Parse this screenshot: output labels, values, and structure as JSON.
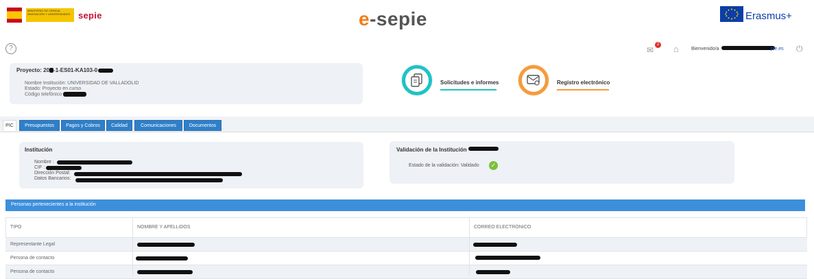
{
  "header": {
    "sepie_logo": "sepie",
    "gov_logo_text": "MINISTERIO DE CIENCIA, INNOVACIÓN Y UNIVERSIDADES",
    "brand_e": "e",
    "brand_rest": "-sepie",
    "erasmus": "Erasmus+"
  },
  "toolbar": {
    "help": "?",
    "mail_badge": "2",
    "welcome": "Bienvenido/a",
    "welcome_link_suffix": "pie.es"
  },
  "project": {
    "title_prefix": "Proyecto: 20",
    "title_mid": "-1-ES01-KA103-0",
    "institution_label": "Nombre Institución:",
    "institution_value": "UNIVERSIDAD DE VALLADOLID",
    "state_label": "Estado:",
    "state_value": "Proyecto en curso",
    "phone_label": "Código telefónico"
  },
  "shortcuts": {
    "solicitudes": "Solicitudes e informes",
    "registro": "Registro electrónico"
  },
  "tabs": [
    "PIC",
    "Presupuestos",
    "Pagos y Cobros",
    "Calidad",
    "Comunicaciones",
    "Documentos"
  ],
  "institution": {
    "heading": "Institución",
    "nombre": "Nombre :",
    "cif": "CIF :",
    "direccion": "Dirección Postal:",
    "datos": "Datos Bancarios:"
  },
  "validation": {
    "heading": "Validación de la Institución",
    "status_label": "Estado de la validación:",
    "status_value": "Validado"
  },
  "persons": {
    "section_title": "Personas pertenecientes a la institución",
    "columns": [
      "TIPO",
      "NOMBRE Y APELLIDOS",
      "CORREO ELECTRÓNICO"
    ],
    "rows": [
      {
        "tipo": "Representante Legal"
      },
      {
        "tipo": "Persona de contacto"
      },
      {
        "tipo": "Persona de contacto"
      }
    ]
  },
  "colors": {
    "tab_blue": "#2f7fc8",
    "section_blue": "#3d8fdc",
    "teal": "#1fc2c5",
    "orange": "#f59b3c",
    "validated_green": "#7cc03a"
  }
}
